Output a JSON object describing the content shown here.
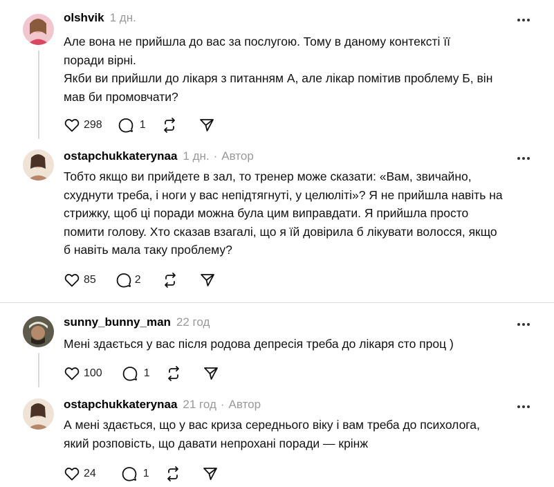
{
  "comments": [
    {
      "username": "olshvik",
      "time": "1 дн.",
      "author_badge": "",
      "lines": [
        "Але вона не прийшла до вас за послугою. Тому в даному контексті її",
        "поради вірні.",
        "Якби ви прийшли до лікаря з питанням А, але лікар помітив проблему Б, він",
        "мав би промовчати?"
      ],
      "likes": "298",
      "replies": "1",
      "avatar_color": "#e7a2b3"
    },
    {
      "username": "ostapchukkaterynaa",
      "time": "1 дн.",
      "author_badge": "Автор",
      "lines": [
        "Тобто якщо ви прийдете в зал, то тренер може сказати: «Вам, звичайно,",
        "схуднути треба, і ноги у вас непідтягнуті, у целюліті»? Я не прийшла навіть на",
        "стрижку, щоб ці поради можна була цим виправдати. Я прийшла просто",
        "помити голову. Хто сказав взагалі, що я їй довірила б лікувати волосся, якщо",
        "б навіть мала таку проблему?"
      ],
      "likes": "85",
      "replies": "2",
      "avatar_color": "#c9a58d"
    },
    {
      "username": "sunny_bunny_man",
      "time": "22 год",
      "author_badge": "",
      "lines": [
        "Мені здається у вас після родова депресія треба до лікаря сто проц )"
      ],
      "likes": "100",
      "replies": "1",
      "avatar_color": "#6f6f5c"
    },
    {
      "username": "ostapchukkaterynaa",
      "time": "21 год",
      "author_badge": "Автор",
      "lines": [
        "А мені здається, що у вас криза середнього віку і вам треба до психолога,",
        "який розповість, що давати непрохані поради — крінж"
      ],
      "likes": "24",
      "replies": "1",
      "avatar_color": "#c9a58d"
    }
  ],
  "separator_label": "Автор"
}
